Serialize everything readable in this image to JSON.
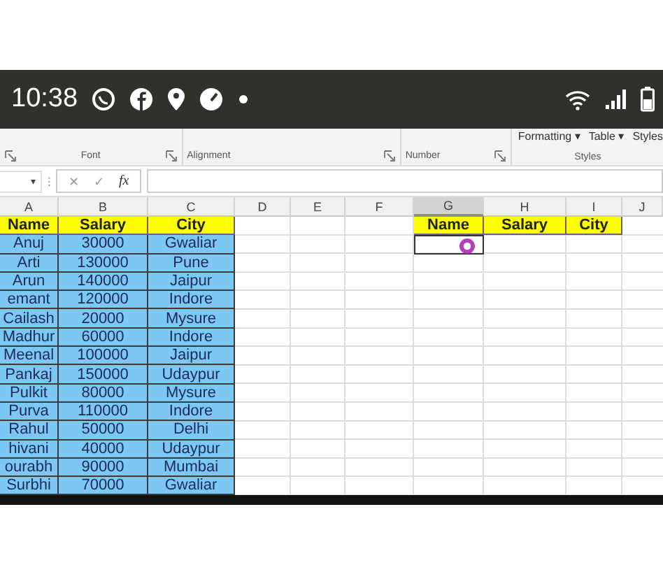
{
  "status_bar": {
    "time": "10:38"
  },
  "ribbon": {
    "groups": [
      {
        "label": "Font"
      },
      {
        "label": "Alignment"
      },
      {
        "label": "Number"
      },
      {
        "label": "Styles",
        "commands": [
          "Formatting ▾",
          "Table ▾",
          "Styles"
        ]
      }
    ]
  },
  "formula_bar": {
    "name_box_caret": "▾",
    "separator": "⁝",
    "cancel": "✕",
    "enter": "✓",
    "function": "fx"
  },
  "sheet": {
    "columns": [
      {
        "label": "A",
        "selected": false
      },
      {
        "label": "B",
        "selected": false
      },
      {
        "label": "C",
        "selected": false
      },
      {
        "label": "D",
        "selected": false
      },
      {
        "label": "E",
        "selected": false
      },
      {
        "label": "F",
        "selected": false
      },
      {
        "label": "G",
        "selected": true
      },
      {
        "label": "H",
        "selected": false
      },
      {
        "label": "I",
        "selected": false
      },
      {
        "label": "J",
        "selected": false
      }
    ],
    "table": {
      "headers": [
        "Name",
        "Salary",
        "City"
      ],
      "rows": [
        {
          "name": "Anuj",
          "salary": "30000",
          "city": "Gwaliar"
        },
        {
          "name": "Arti",
          "salary": "130000",
          "city": "Pune"
        },
        {
          "name": "Arun",
          "salary": "140000",
          "city": "Jaipur"
        },
        {
          "name": "emant",
          "salary": "120000",
          "city": "Indore"
        },
        {
          "name": "Cailash",
          "salary": "20000",
          "city": "Mysure"
        },
        {
          "name": "Madhur",
          "salary": "60000",
          "city": "Indore"
        },
        {
          "name": "Meenal",
          "salary": "100000",
          "city": "Jaipur"
        },
        {
          "name": "Pankaj",
          "salary": "150000",
          "city": "Udaypur"
        },
        {
          "name": "Pulkit",
          "salary": "80000",
          "city": "Mysure"
        },
        {
          "name": "Purva",
          "salary": "110000",
          "city": "Indore"
        },
        {
          "name": "Rahul",
          "salary": "50000",
          "city": "Delhi"
        },
        {
          "name": "hivani",
          "salary": "40000",
          "city": "Udaypur"
        },
        {
          "name": "ourabh",
          "salary": "90000",
          "city": "Mumbai"
        },
        {
          "name": "Surbhi",
          "salary": "70000",
          "city": "Gwaliar"
        }
      ]
    },
    "lookup": {
      "headers": [
        "Name",
        "Salary",
        "City"
      ],
      "active_cell": true
    }
  }
}
